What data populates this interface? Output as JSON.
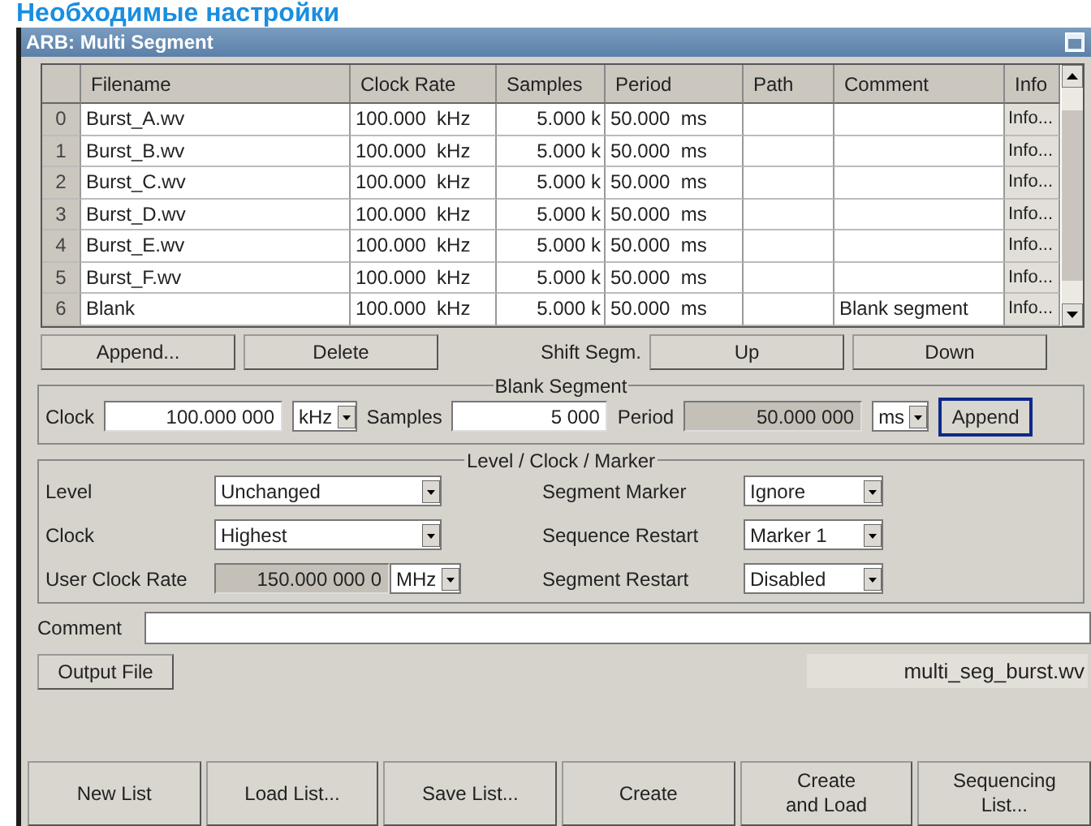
{
  "heading": "Необходимые настройки",
  "window": {
    "title": "ARB: Multi Segment"
  },
  "table": {
    "columns": [
      "Filename",
      "Clock Rate",
      "Samples",
      "Period",
      "Path",
      "Comment",
      "Info"
    ],
    "rows": [
      {
        "index": "0",
        "filename": "Burst_A.wv",
        "clock_rate": "100.000  kHz",
        "samples": "5.000 k",
        "period": "50.000  ms",
        "info": "Info..."
      },
      {
        "index": "1",
        "filename": "Burst_B.wv",
        "clock_rate": "100.000  kHz",
        "samples": "5.000 k",
        "period": "50.000  ms",
        "info": "Info..."
      },
      {
        "index": "2",
        "filename": "Burst_C.wv",
        "clock_rate": "100.000  kHz",
        "samples": "5.000 k",
        "period": "50.000  ms",
        "info": "Info..."
      },
      {
        "index": "3",
        "filename": "Burst_D.wv",
        "clock_rate": "100.000  kHz",
        "samples": "5.000 k",
        "period": "50.000  ms",
        "info": "Info..."
      },
      {
        "index": "4",
        "filename": "Burst_E.wv",
        "clock_rate": "100.000  kHz",
        "samples": "5.000 k",
        "period": "50.000  ms",
        "info": "Info..."
      },
      {
        "index": "5",
        "filename": "Burst_F.wv",
        "clock_rate": "100.000  kHz",
        "samples": "5.000 k",
        "period": "50.000  ms",
        "info": "Info..."
      },
      {
        "index": "6",
        "filename": "Blank",
        "clock_rate": "100.000  kHz",
        "samples": "5.000 k",
        "period": "50.000  ms",
        "comment": "Blank segment",
        "info": "Info..."
      }
    ]
  },
  "segment_buttons": {
    "append": "Append...",
    "delete": "Delete",
    "shift_label": "Shift Segm.",
    "up": "Up",
    "down": "Down"
  },
  "blank_segment": {
    "legend": "Blank Segment",
    "clock": {
      "label": "Clock",
      "value": "100.000 000",
      "unit": "kHz",
      "disabled": false
    },
    "samples": {
      "label": "Samples",
      "value": "5 000",
      "disabled": false
    },
    "period": {
      "label": "Period",
      "value": "50.000 000",
      "unit": "ms",
      "disabled": true
    },
    "append": {
      "label": "Append",
      "focused": true
    }
  },
  "level_clock_marker": {
    "legend": "Level / Clock / Marker",
    "left": [
      {
        "label": "Level",
        "value": "Unchanged"
      },
      {
        "label": "Clock",
        "value": "Highest"
      },
      {
        "label": "User Clock Rate",
        "value": "150.000 000 0",
        "unit": "MHz",
        "disabled": true
      }
    ],
    "right": [
      {
        "label": "Segment Marker",
        "value": "Ignore"
      },
      {
        "label": "Sequence Restart",
        "value": "Marker 1"
      },
      {
        "label": "Segment Restart",
        "value": "Disabled"
      }
    ]
  },
  "comment": {
    "label": "Comment"
  },
  "output_file": {
    "button": "Output File",
    "value": "multi_seg_burst.wv"
  },
  "bottom_buttons": [
    "New List",
    "Load List...",
    "Save List...",
    "Create",
    "Create\nand Load",
    "Sequencing\nList..."
  ]
}
